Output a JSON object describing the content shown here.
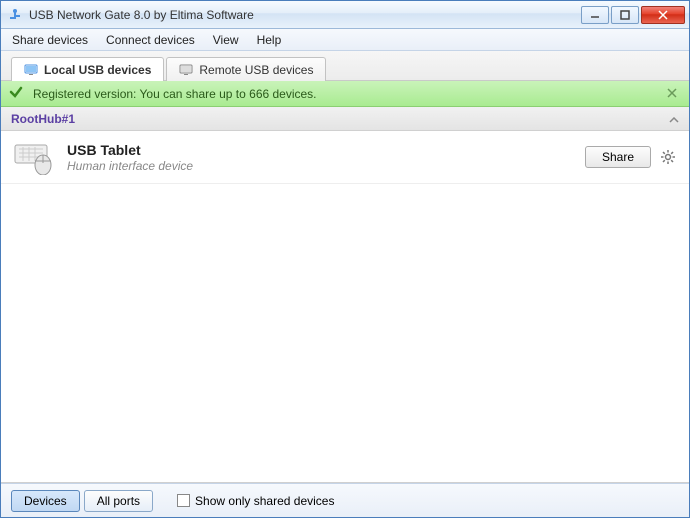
{
  "window": {
    "title": "USB Network Gate 8.0 by Eltima Software"
  },
  "menu": {
    "share": "Share devices",
    "connect": "Connect devices",
    "view": "View",
    "help": "Help"
  },
  "tabs": {
    "local": "Local USB devices",
    "remote": "Remote USB devices"
  },
  "banner": {
    "text": "Registered version: You can share up to 666 devices."
  },
  "hub": {
    "name": "RootHub#1"
  },
  "devices": [
    {
      "name": "USB Tablet",
      "desc": "Human interface device",
      "share_label": "Share"
    }
  ],
  "bottom": {
    "devices": "Devices",
    "allports": "All ports",
    "filter_label": "Show only shared devices"
  }
}
